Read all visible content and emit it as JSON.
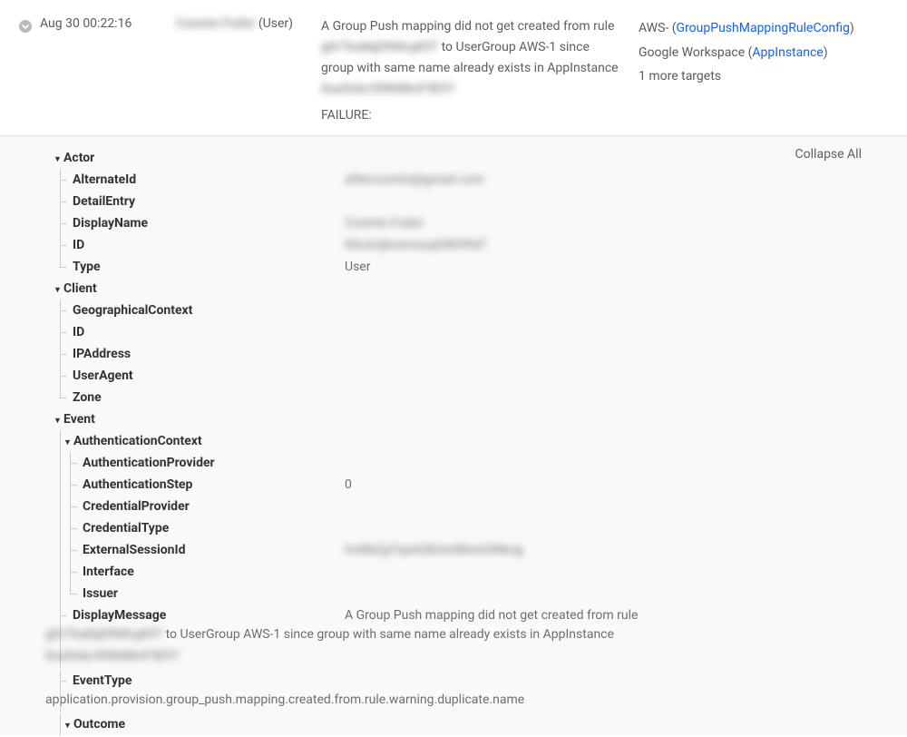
{
  "summary": {
    "time": "Aug 30 00:22:16",
    "actor_name_blurred": "Cosmin Fodor",
    "actor_suffix": " (User)",
    "msg_part1": "A Group Push mapping did not get created from rule ",
    "msg_rule_id": "g0r76ukbj096Kuj697",
    "msg_part2": " to UserGroup AWS-1 since group with same name already exists in AppInstance ",
    "msg_instance_id": "0oa5nbc59868knF5E97",
    "failure_label": "FAILURE:",
    "targets": {
      "t1_prefix": "AWS-  (",
      "t1_link": "GroupPushMappingRuleConfig",
      "t1_suffix": ")",
      "t2_prefix": "Google Workspace  (",
      "t2_link": "AppInstance",
      "t2_suffix": ")",
      "more": "1 more targets"
    }
  },
  "collapse_all": "Collapse All",
  "tree": {
    "actor": {
      "header": "Actor",
      "rows": [
        {
          "k": "AlternateId",
          "v": "aftercosmin@gmail.com",
          "blur": true
        },
        {
          "k": "DetailEntry",
          "v": ""
        },
        {
          "k": "DisplayName",
          "v": "Cosmin Fodor",
          "blur": true
        },
        {
          "k": "ID",
          "v": "00u2cjbnsmnuq03K99d7",
          "blur": true
        },
        {
          "k": "Type",
          "v": "User"
        }
      ]
    },
    "client": {
      "header": "Client",
      "rows": [
        {
          "k": "GeographicalContext",
          "v": ""
        },
        {
          "k": "ID",
          "v": ""
        },
        {
          "k": "IPAddress",
          "v": ""
        },
        {
          "k": "UserAgent",
          "v": ""
        },
        {
          "k": "Zone",
          "v": ""
        }
      ]
    },
    "event": {
      "header": "Event",
      "auth_header": "AuthenticationContext",
      "auth_rows": [
        {
          "k": "AuthenticationProvider",
          "v": ""
        },
        {
          "k": "AuthenticationStep",
          "v": "0"
        },
        {
          "k": "CredentialProvider",
          "v": ""
        },
        {
          "k": "CredentialType",
          "v": ""
        },
        {
          "k": "ExternalSessionId",
          "v": "trsNkZgTopAQ82er88owGNkog",
          "blur": true
        },
        {
          "k": "Interface",
          "v": ""
        },
        {
          "k": "Issuer",
          "v": ""
        }
      ],
      "display_msg_key": "DisplayMessage",
      "display_msg_inline": "A Group Push mapping did not get created from rule",
      "display_msg_line2_blur1": "g0r76ukbj096Kuj697",
      "display_msg_line2_mid": " to UserGroup AWS-1 since group with same name already exists in AppInstance",
      "display_msg_line3_blur": "0oa5nbc59868knF5E97",
      "event_type_key": "EventType",
      "event_type_val": "application.provision.group_push.mapping.created.from.rule.warning.duplicate.name",
      "outcome_header": "Outcome"
    }
  }
}
